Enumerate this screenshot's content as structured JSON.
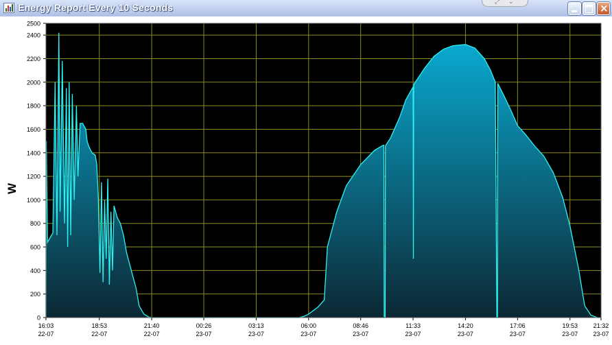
{
  "window": {
    "title": "Energy Report Every 10 Seconds",
    "buttons": [
      "minimize",
      "maximize",
      "close"
    ],
    "icons": {
      "app": "bar-chart-icon",
      "extra_tab": [
        "resize-icon",
        "chevron-down-icon"
      ]
    }
  },
  "colors": {
    "plot_background": "#000000",
    "grid": "#8c8c1e",
    "series_line": "#2ef2f2",
    "fill_top": "#0aaed6",
    "fill_bottom": "#0c2834",
    "axis_text": "#000000",
    "page_background": "#ffffff"
  },
  "chart_data": {
    "type": "area",
    "ylabel": "W",
    "ylim": [
      0,
      2500
    ],
    "y_ticks": [
      0,
      200,
      400,
      600,
      800,
      1000,
      1200,
      1400,
      1600,
      1800,
      2000,
      2200,
      2400,
      2500
    ],
    "xlim": [
      "2023-07-22 16:03",
      "2023-07-23 21:32"
    ],
    "x_ticks": [
      {
        "time": "16:03",
        "date": "22-07"
      },
      {
        "time": "18:53",
        "date": "22-07"
      },
      {
        "time": "21:40",
        "date": "22-07"
      },
      {
        "time": "00:26",
        "date": "23-07"
      },
      {
        "time": "03:13",
        "date": "23-07"
      },
      {
        "time": "06:00",
        "date": "23-07"
      },
      {
        "time": "08:46",
        "date": "23-07"
      },
      {
        "time": "11:33",
        "date": "23-07"
      },
      {
        "time": "14:20",
        "date": "23-07"
      },
      {
        "time": "17:06",
        "date": "23-07"
      },
      {
        "time": "19:53",
        "date": "23-07"
      },
      {
        "time": "21:32",
        "date": "23-07"
      }
    ],
    "grid": true,
    "legend": "none",
    "series": [
      {
        "values": [
          [
            "22-07 16:03",
            0
          ],
          [
            "22-07 16:04",
            1500
          ],
          [
            "22-07 16:08",
            640
          ],
          [
            "22-07 16:25",
            720
          ],
          [
            "22-07 16:32",
            2000
          ],
          [
            "22-07 16:38",
            700
          ],
          [
            "22-07 16:44",
            2420
          ],
          [
            "22-07 16:48",
            900
          ],
          [
            "22-07 16:55",
            2180
          ],
          [
            "22-07 17:02",
            800
          ],
          [
            "22-07 17:08",
            1950
          ],
          [
            "22-07 17:12",
            600
          ],
          [
            "22-07 17:17",
            2000
          ],
          [
            "22-07 17:22",
            700
          ],
          [
            "22-07 17:27",
            1900
          ],
          [
            "22-07 17:33",
            1000
          ],
          [
            "22-07 17:40",
            1800
          ],
          [
            "22-07 17:45",
            1200
          ],
          [
            "22-07 17:52",
            1650
          ],
          [
            "22-07 18:00",
            1650
          ],
          [
            "22-07 18:10",
            1600
          ],
          [
            "22-07 18:14",
            1500
          ],
          [
            "22-07 18:20",
            1450
          ],
          [
            "22-07 18:30",
            1400
          ],
          [
            "22-07 18:40",
            1380
          ],
          [
            "22-07 18:45",
            1300
          ],
          [
            "22-07 18:50",
            1000
          ],
          [
            "22-07 18:55",
            380
          ],
          [
            "22-07 19:00",
            1150
          ],
          [
            "22-07 19:05",
            300
          ],
          [
            "22-07 19:10",
            1000
          ],
          [
            "22-07 19:15",
            500
          ],
          [
            "22-07 19:20",
            1180
          ],
          [
            "22-07 19:25",
            280
          ],
          [
            "22-07 19:30",
            900
          ],
          [
            "22-07 19:35",
            400
          ],
          [
            "22-07 19:40",
            950
          ],
          [
            "22-07 19:50",
            850
          ],
          [
            "22-07 20:00",
            800
          ],
          [
            "22-07 20:10",
            700
          ],
          [
            "22-07 20:20",
            550
          ],
          [
            "22-07 20:35",
            400
          ],
          [
            "22-07 20:50",
            250
          ],
          [
            "22-07 21:00",
            100
          ],
          [
            "22-07 21:15",
            30
          ],
          [
            "22-07 21:30",
            5
          ],
          [
            "22-07 21:40",
            0
          ],
          [
            "23-07 05:30",
            0
          ],
          [
            "23-07 05:45",
            10
          ],
          [
            "23-07 06:00",
            30
          ],
          [
            "23-07 06:30",
            90
          ],
          [
            "23-07 06:50",
            150
          ],
          [
            "23-07 07:00",
            600
          ],
          [
            "23-07 07:30",
            900
          ],
          [
            "23-07 08:00",
            1120
          ],
          [
            "23-07 08:46",
            1300
          ],
          [
            "23-07 09:30",
            1420
          ],
          [
            "23-07 09:55",
            1460
          ],
          [
            "23-07 10:00",
            1465
          ],
          [
            "23-07 10:01",
            0
          ],
          [
            "23-07 10:04",
            0
          ],
          [
            "23-07 10:05",
            1460
          ],
          [
            "23-07 10:20",
            1520
          ],
          [
            "23-07 10:50",
            1700
          ],
          [
            "23-07 11:10",
            1850
          ],
          [
            "23-07 11:33",
            1960
          ],
          [
            "23-07 11:34",
            500
          ],
          [
            "23-07 11:35",
            1980
          ],
          [
            "23-07 12:10",
            2120
          ],
          [
            "23-07 12:40",
            2220
          ],
          [
            "23-07 13:10",
            2280
          ],
          [
            "23-07 13:40",
            2310
          ],
          [
            "23-07 14:20",
            2320
          ],
          [
            "23-07 14:50",
            2290
          ],
          [
            "23-07 15:20",
            2200
          ],
          [
            "23-07 15:40",
            2100
          ],
          [
            "23-07 15:55",
            2000
          ],
          [
            "23-07 16:00",
            0
          ],
          [
            "23-07 16:02",
            0
          ],
          [
            "23-07 16:03",
            1990
          ],
          [
            "23-07 16:20",
            1900
          ],
          [
            "23-07 16:45",
            1760
          ],
          [
            "23-07 17:06",
            1630
          ],
          [
            "23-07 17:30",
            1560
          ],
          [
            "23-07 18:00",
            1460
          ],
          [
            "23-07 18:30",
            1370
          ],
          [
            "23-07 19:00",
            1230
          ],
          [
            "23-07 19:30",
            1020
          ],
          [
            "23-07 19:53",
            780
          ],
          [
            "23-07 20:20",
            420
          ],
          [
            "23-07 20:40",
            100
          ],
          [
            "23-07 21:00",
            20
          ],
          [
            "23-07 21:20",
            0
          ],
          [
            "23-07 21:32",
            0
          ]
        ]
      }
    ]
  }
}
